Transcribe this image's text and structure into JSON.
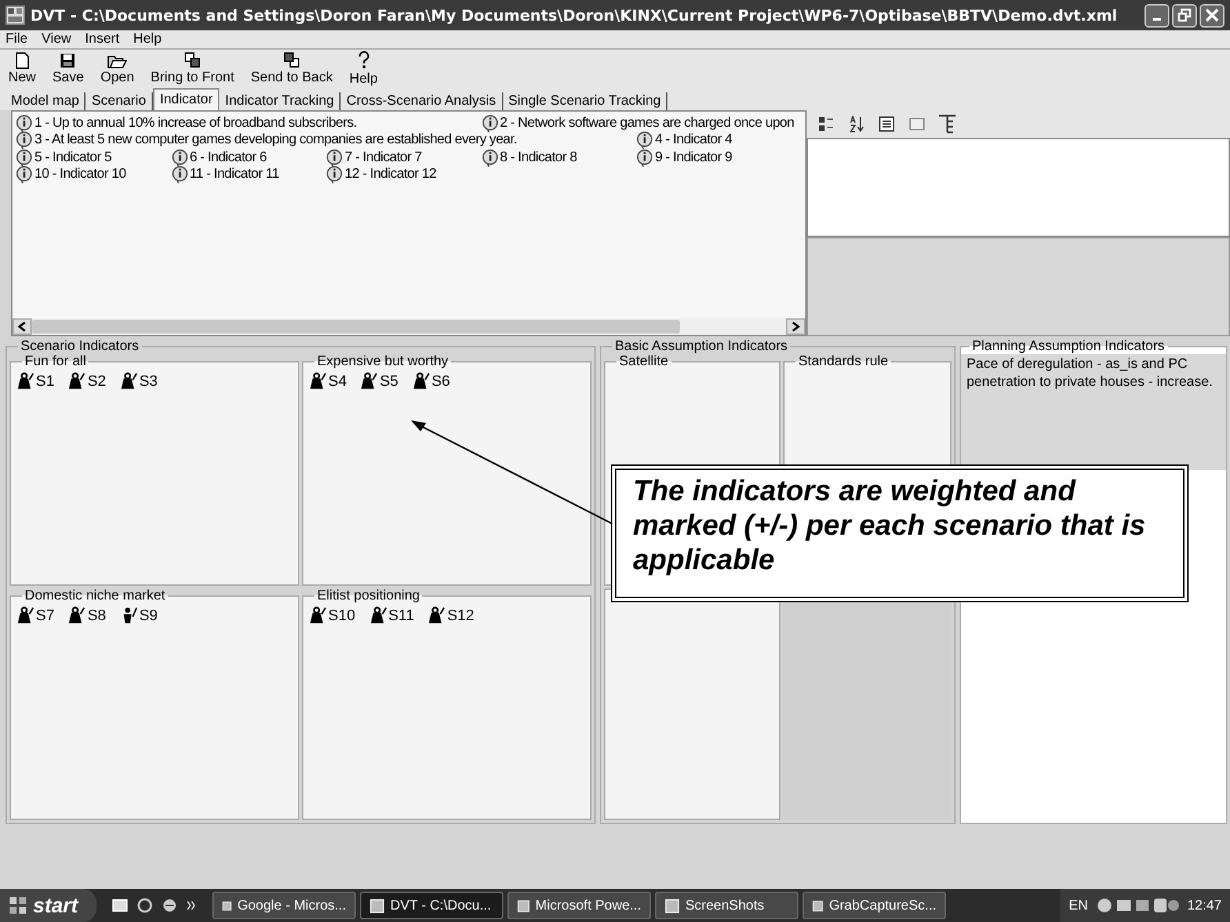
{
  "window": {
    "title": "DVT - C:\\Documents and Settings\\Doron Faran\\My Documents\\Doron\\KINX\\Current Project\\WP6-7\\Optibase\\BBTV\\Demo.dvt.xml"
  },
  "menu": [
    "File",
    "View",
    "Insert",
    "Help"
  ],
  "toolbar": [
    {
      "label": "New",
      "kind": "new"
    },
    {
      "label": "Save",
      "kind": "save"
    },
    {
      "label": "Open",
      "kind": "open"
    },
    {
      "label": "Bring to Front",
      "kind": "front"
    },
    {
      "label": "Send to Back",
      "kind": "back"
    },
    {
      "label": "Help",
      "kind": "help"
    }
  ],
  "tabs": [
    {
      "label": "Model map",
      "selected": false
    },
    {
      "label": "Scenario",
      "selected": false
    },
    {
      "label": "Indicator",
      "selected": true
    },
    {
      "label": "Indicator Tracking",
      "selected": false
    },
    {
      "label": "Cross-Scenario Analysis",
      "selected": false
    },
    {
      "label": "Single Scenario Tracking",
      "selected": false
    }
  ],
  "indicators": [
    {
      "label": "1 - Up to annual 10% increase of broadband subscribers."
    },
    {
      "label": "2 - Network software games are charged once upon"
    },
    {
      "label": "3 - At least 5 new computer games developing companies are established every year."
    },
    {
      "label": "4 - Indicator 4"
    },
    {
      "label": "5 - Indicator 5"
    },
    {
      "label": "6 - Indicator 6"
    },
    {
      "label": "7 - Indicator 7"
    },
    {
      "label": "8 - Indicator 8"
    },
    {
      "label": "9 - Indicator 9"
    },
    {
      "label": "10 - Indicator 10"
    },
    {
      "label": "11 - Indicator 11"
    },
    {
      "label": "12 - Indicator 12"
    }
  ],
  "scenario_indicators": {
    "title": "Scenario Indicators",
    "groups": [
      {
        "title": "Fun for all",
        "items": [
          {
            "label": "S1",
            "kind": "weight"
          },
          {
            "label": "S2",
            "kind": "weight"
          },
          {
            "label": "S3",
            "kind": "weight"
          }
        ]
      },
      {
        "title": "Expensive but worthy",
        "items": [
          {
            "label": "S4",
            "kind": "weight"
          },
          {
            "label": "S5",
            "kind": "weight"
          },
          {
            "label": "S6",
            "kind": "weight"
          }
        ]
      },
      {
        "title": "Domestic niche market",
        "items": [
          {
            "label": "S7",
            "kind": "weight"
          },
          {
            "label": "S8",
            "kind": "weight"
          },
          {
            "label": "S9",
            "kind": "figure"
          }
        ]
      },
      {
        "title": "Elitist positioning",
        "items": [
          {
            "label": "S10",
            "kind": "weight"
          },
          {
            "label": "S11",
            "kind": "weight"
          },
          {
            "label": "S12",
            "kind": "weight"
          }
        ]
      }
    ]
  },
  "basic_assumption_indicators": {
    "title": "Basic Assumption Indicators",
    "groups": [
      {
        "title": "Satellite"
      },
      {
        "title": "Standards rule"
      }
    ]
  },
  "planning_assumption_indicators": {
    "title": "Planning Assumption Indicators",
    "text": "Pace of deregulation  - as_is and PC penetration to private houses - increase."
  },
  "callout": {
    "text": "The indicators are weighted and marked (+/-) per each scenario that is applicable"
  },
  "taskbar": {
    "start": "start",
    "buttons": [
      {
        "label": "Google - Micros...",
        "selected": false
      },
      {
        "label": "DVT - C:\\Docu...",
        "selected": true
      },
      {
        "label": "Microsoft Powe...",
        "selected": false
      },
      {
        "label": "ScreenShots",
        "selected": false
      },
      {
        "label": "GrabCaptureSc...",
        "selected": false
      }
    ],
    "language": "EN",
    "time": "12:47"
  }
}
